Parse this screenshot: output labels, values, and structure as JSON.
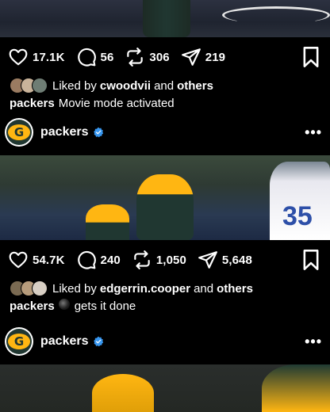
{
  "colors": {
    "background": "#000000",
    "text": "#ffffff",
    "verified_blue": "#3897f0",
    "packers_green": "#203731",
    "packers_gold": "#ffb612"
  },
  "post1": {
    "actions": {
      "likes": "17.1K",
      "comments": "56",
      "reposts": "306",
      "shares": "219"
    },
    "liked_by": {
      "prefix": "Liked by",
      "user": "cwoodvii",
      "and": "and",
      "others": "others"
    },
    "caption": {
      "user": "packers",
      "text": "Movie mode activated"
    }
  },
  "post2": {
    "header": {
      "logo_letter": "G",
      "username": "packers",
      "more": "•••"
    },
    "media": {
      "jersey_number": "35"
    },
    "actions": {
      "likes": "54.7K",
      "comments": "240",
      "reposts": "1,050",
      "shares": "5,648"
    },
    "liked_by": {
      "prefix": "Liked by",
      "user": "edgerrin.cooper",
      "and": "and",
      "others": "others"
    },
    "caption": {
      "user": "packers",
      "text": "gets it done"
    }
  },
  "post3": {
    "header": {
      "logo_letter": "G",
      "username": "packers",
      "more": "•••"
    }
  },
  "icons": [
    "heart-icon",
    "comment-icon",
    "repost-icon",
    "share-icon",
    "bookmark-icon",
    "verified-icon",
    "more-icon"
  ]
}
